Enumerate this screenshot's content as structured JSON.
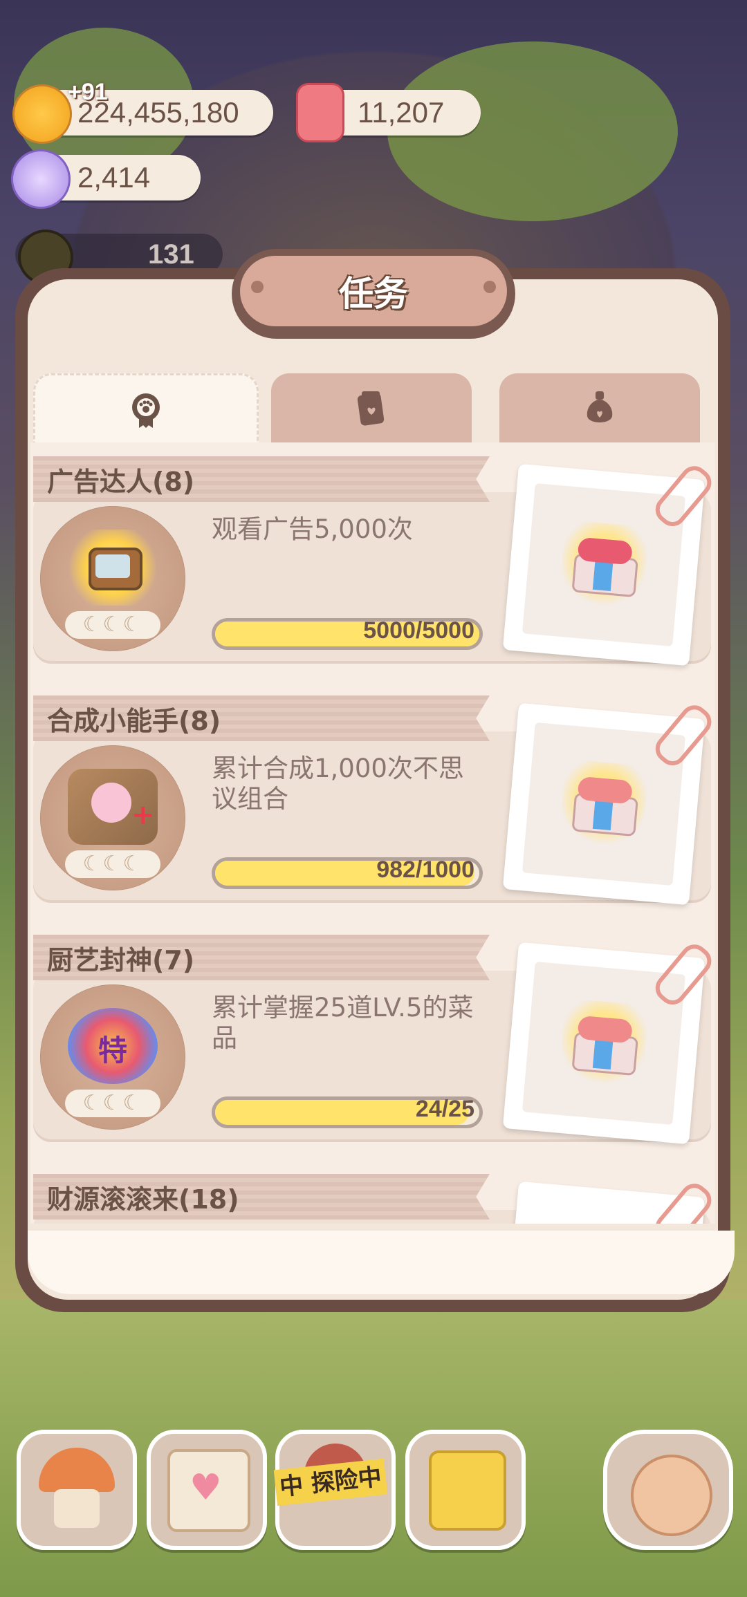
{
  "resources": {
    "coins": "224,455,180",
    "coins_delta": "+91",
    "candle": "11,207",
    "gem": "2,414",
    "level_count": "131"
  },
  "panel": {
    "title": "任务",
    "tabs": [
      {
        "icon": "paw-medal-icon",
        "active": true
      },
      {
        "icon": "tablet-heart-icon",
        "active": false
      },
      {
        "icon": "flower-bottle-icon",
        "active": false
      }
    ]
  },
  "tasks": [
    {
      "title": "广告达人(8)",
      "description": "观看广告5,000次",
      "progress": "5000/5000",
      "progress_fraction": 1.0,
      "moons": "☾☾☾",
      "badge_icon": "tv-icon"
    },
    {
      "title": "合成小能手(8)",
      "description": "累计合成1,000次不思议组合",
      "progress": "982/1000",
      "progress_fraction": 0.982,
      "moons": "☾☾☾",
      "badge_icon": "merge-icon"
    },
    {
      "title": "厨艺封神(7)",
      "description": "累计掌握25道LV.5的菜品",
      "progress": "24/25",
      "progress_fraction": 0.96,
      "moons": "☾☾☾",
      "badge_icon": "special-dish-icon"
    },
    {
      "title": "财源滚滚来(18)"
    }
  ],
  "bottom_nav": {
    "explore_banner": "中 探险中"
  },
  "colors": {
    "panel_border": "#6b4c44",
    "progress_fill": "#ffe36a",
    "text_main": "#6b5247"
  }
}
